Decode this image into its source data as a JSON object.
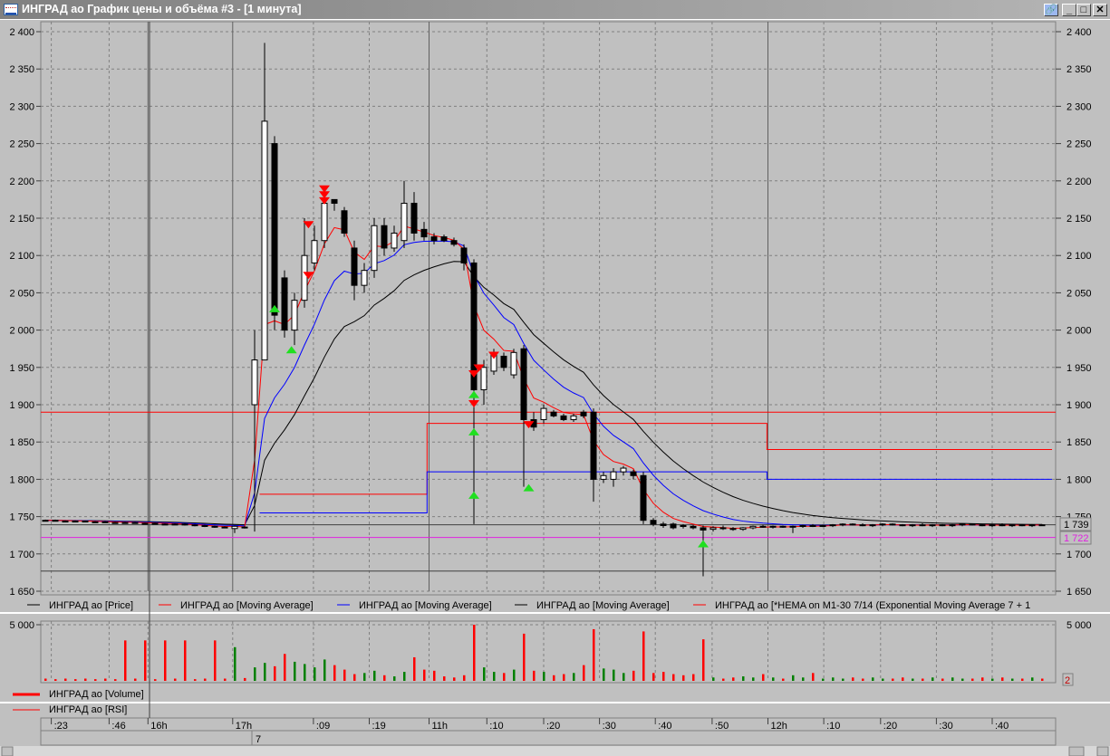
{
  "window": {
    "title": "ИНГРАД ао График цены и объёма #3 - [1 минута]",
    "min_glyph": "_",
    "max_glyph": "□",
    "close_glyph": "✕",
    "link_glyph": "🔗"
  },
  "colors": {
    "bg": "#c0c0c0",
    "grid": "#808080",
    "up": "#ffffff",
    "down": "#000000",
    "ma_red": "#ff0000",
    "ma_blue": "#0000ff",
    "ma_black": "#000000",
    "magenta": "#e020e0",
    "vol_up": "#008000",
    "vol_down": "#ff0000"
  },
  "legend": [
    {
      "label": "ИНГРАД ао [Price]",
      "color": "#000000"
    },
    {
      "label": "ИНГРАД ао [Moving Average]",
      "color": "#ff0000"
    },
    {
      "label": "ИНГРАД ао [Moving Average]",
      "color": "#0000ff"
    },
    {
      "label": "ИНГРАД ао [Moving Average]",
      "color": "#000000"
    },
    {
      "label": "ИНГРАД ао [*HEMA on M1-30 7/14 (Exponential Moving Average 7 + 1",
      "color": "#ff0000"
    }
  ],
  "volume_legend": "ИНГРАД ао [Volume]",
  "rsi_legend": "ИНГРАД ао [RSI]",
  "chart_data": {
    "type": "candlestick",
    "ylim": [
      1650,
      2400
    ],
    "yticks": [
      "2 400",
      "2 350",
      "2 300",
      "2 250",
      "2 200",
      "2 150",
      "2 100",
      "2 050",
      "2 000",
      "1 950",
      "1 900",
      "1 850",
      "1 800",
      "1 750",
      "1 700",
      "1 650"
    ],
    "ytick_values": [
      2400,
      2350,
      2300,
      2250,
      2200,
      2150,
      2100,
      2050,
      2000,
      1950,
      1900,
      1850,
      1800,
      1750,
      1700,
      1650
    ],
    "time_labels": [
      ":23",
      ":46",
      "16h",
      "17h",
      ":09",
      ":19",
      "11h",
      ":10",
      ":20",
      ":30",
      ":40",
      ":50",
      "12h",
      ":10",
      ":20",
      ":30",
      ":40"
    ],
    "time_label_bars": [
      0.6,
      6.4,
      10.3,
      18.8,
      26.9,
      32.5,
      38.5,
      44.3,
      50,
      55.6,
      61.2,
      66.9,
      72.5,
      78.1,
      83.8,
      89.4,
      95
    ],
    "date_label": "7",
    "ohlc": [
      [
        1745,
        1746,
        1744,
        1745
      ],
      [
        1745,
        1746,
        1744,
        1745
      ],
      [
        1744,
        1745,
        1743,
        1744
      ],
      [
        1744,
        1745,
        1743,
        1744
      ],
      [
        1744,
        1745,
        1743,
        1744
      ],
      [
        1743,
        1744,
        1742,
        1743
      ],
      [
        1743,
        1744,
        1742,
        1743
      ],
      [
        1742,
        1743,
        1741,
        1742
      ],
      [
        1742,
        1743,
        1741,
        1742
      ],
      [
        1742,
        1743,
        1741,
        1742
      ],
      [
        1741,
        1742,
        1740,
        1741
      ],
      [
        1741,
        1742,
        1740,
        1741
      ],
      [
        1740,
        1741,
        1739,
        1740
      ],
      [
        1740,
        1741,
        1739,
        1740
      ],
      [
        1740,
        1741,
        1738,
        1739
      ],
      [
        1739,
        1740,
        1737,
        1738
      ],
      [
        1738,
        1739,
        1736,
        1737
      ],
      [
        1737,
        1738,
        1735,
        1736
      ],
      [
        1736,
        1737,
        1735,
        1736
      ],
      [
        1734,
        1738,
        1728,
        1737
      ],
      [
        1736,
        1737,
        1734,
        1735
      ],
      [
        1900,
        2000,
        1730,
        1960
      ],
      [
        1960,
        2385,
        1960,
        2280
      ],
      [
        2250,
        2260,
        2000,
        2020
      ],
      [
        2070,
        2080,
        1990,
        2000
      ],
      [
        2000,
        2050,
        1980,
        2040
      ],
      [
        2040,
        2150,
        2030,
        2100
      ],
      [
        2090,
        2140,
        2080,
        2120
      ],
      [
        2120,
        2180,
        2110,
        2170
      ],
      [
        2175,
        2175,
        2160,
        2170
      ],
      [
        2160,
        2165,
        2125,
        2130
      ],
      [
        2110,
        2120,
        2040,
        2060
      ],
      [
        2060,
        2090,
        2050,
        2080
      ],
      [
        2080,
        2150,
        2070,
        2140
      ],
      [
        2140,
        2150,
        2100,
        2110
      ],
      [
        2110,
        2140,
        2105,
        2130
      ],
      [
        2120,
        2200,
        2110,
        2170
      ],
      [
        2170,
        2185,
        2120,
        2130
      ],
      [
        2135,
        2145,
        2120,
        2125
      ],
      [
        2125,
        2130,
        2115,
        2120
      ],
      [
        2125,
        2128,
        2118,
        2120
      ],
      [
        2120,
        2124,
        2112,
        2115
      ],
      [
        2110,
        2115,
        2080,
        2090
      ],
      [
        2090,
        2095,
        1740,
        1920
      ],
      [
        1920,
        1960,
        1900,
        1950
      ],
      [
        1945,
        1975,
        1940,
        1970
      ],
      [
        1965,
        1970,
        1945,
        1950
      ],
      [
        1940,
        1975,
        1935,
        1970
      ],
      [
        1975,
        1980,
        1790,
        1880
      ],
      [
        1880,
        1890,
        1865,
        1870
      ],
      [
        1880,
        1900,
        1875,
        1895
      ],
      [
        1890,
        1893,
        1883,
        1885
      ],
      [
        1885,
        1888,
        1878,
        1880
      ],
      [
        1880,
        1888,
        1877,
        1885
      ],
      [
        1890,
        1893,
        1882,
        1885
      ],
      [
        1890,
        1895,
        1770,
        1800
      ],
      [
        1800,
        1810,
        1795,
        1805
      ],
      [
        1800,
        1815,
        1790,
        1810
      ],
      [
        1810,
        1818,
        1805,
        1815
      ],
      [
        1810,
        1813,
        1800,
        1805
      ],
      [
        1805,
        1810,
        1740,
        1745
      ],
      [
        1745,
        1748,
        1737,
        1740
      ],
      [
        1740,
        1743,
        1735,
        1738
      ],
      [
        1740,
        1742,
        1733,
        1735
      ],
      [
        1738,
        1740,
        1734,
        1737
      ],
      [
        1737,
        1739,
        1733,
        1735
      ],
      [
        1735,
        1738,
        1670,
        1732
      ],
      [
        1733,
        1737,
        1730,
        1735
      ],
      [
        1735,
        1738,
        1732,
        1734
      ],
      [
        1734,
        1736,
        1731,
        1733
      ],
      [
        1733,
        1736,
        1731,
        1735
      ],
      [
        1735,
        1738,
        1733,
        1737
      ],
      [
        1737,
        1739,
        1735,
        1736
      ],
      [
        1736,
        1738,
        1734,
        1737
      ],
      [
        1737,
        1738,
        1735,
        1736
      ],
      [
        1736,
        1738,
        1728,
        1737
      ],
      [
        1737,
        1739,
        1735,
        1738
      ],
      [
        1738,
        1740,
        1736,
        1737
      ],
      [
        1737,
        1739,
        1736,
        1738
      ],
      [
        1738,
        1740,
        1736,
        1739
      ],
      [
        1739,
        1741,
        1737,
        1740
      ],
      [
        1740,
        1741,
        1738,
        1739
      ],
      [
        1739,
        1741,
        1737,
        1738
      ],
      [
        1738,
        1740,
        1736,
        1739
      ],
      [
        1739,
        1741,
        1737,
        1740
      ],
      [
        1740,
        1741,
        1738,
        1739
      ],
      [
        1739,
        1740,
        1737,
        1738
      ],
      [
        1738,
        1740,
        1736,
        1739
      ],
      [
        1739,
        1741,
        1737,
        1738
      ],
      [
        1738,
        1740,
        1736,
        1739
      ],
      [
        1739,
        1740,
        1737,
        1738
      ],
      [
        1738,
        1740,
        1736,
        1739
      ],
      [
        1739,
        1741,
        1737,
        1740
      ],
      [
        1740,
        1741,
        1738,
        1739
      ],
      [
        1739,
        1740,
        1737,
        1738
      ],
      [
        1738,
        1740,
        1736,
        1739
      ],
      [
        1739,
        1741,
        1737,
        1738
      ],
      [
        1738,
        1740,
        1736,
        1739
      ],
      [
        1739,
        1740,
        1737,
        1738
      ],
      [
        1738,
        1740,
        1736,
        1739
      ],
      [
        1739,
        1740,
        1738,
        1739
      ]
    ],
    "ma_periods": {
      "red": 4,
      "blue": 9,
      "black": 16
    },
    "volume": [
      200,
      150,
      200,
      150,
      200,
      150,
      200,
      150,
      3600,
      200,
      3600,
      150,
      3600,
      200,
      3600,
      150,
      200,
      3600,
      200,
      3000,
      250,
      1200,
      1600,
      1300,
      2400,
      1700,
      1500,
      1200,
      1900,
      1400,
      1000,
      600,
      700,
      900,
      500,
      400,
      800,
      2100,
      1000,
      900,
      400,
      300,
      500,
      5000,
      1200,
      800,
      700,
      1000,
      4200,
      900,
      800,
      500,
      600,
      700,
      1400,
      4600,
      1100,
      1000,
      700,
      900,
      4400,
      700,
      800,
      600,
      500,
      600,
      3700,
      300,
      200,
      300,
      400,
      300,
      600,
      300,
      200,
      500,
      300,
      700,
      200,
      300,
      200,
      300,
      200,
      300,
      200,
      200,
      300,
      200,
      200,
      300,
      200,
      300,
      200,
      200,
      300,
      200,
      300,
      200,
      200,
      300,
      200
    ],
    "volume_ylim": [
      0,
      5000
    ],
    "volume_ticks": [
      "5 000"
    ],
    "volume_last": "2",
    "last_price": "1 739",
    "level_price": "1 722",
    "hlines": [
      {
        "price": 1890,
        "color": "#ff0000"
      },
      {
        "price": 1722,
        "color": "#e020e0"
      },
      {
        "price": 1739,
        "color": "#404040"
      },
      {
        "price": 1677,
        "color": "#404040"
      }
    ],
    "step_lines": [
      {
        "color": "#ff0000",
        "segments": [
          [
            21.5,
            38.3,
            1780
          ],
          [
            38.3,
            72.4,
            1875
          ],
          [
            72.4,
            101,
            1840
          ]
        ]
      },
      {
        "color": "#0000ff",
        "segments": [
          [
            21.5,
            38.3,
            1755
          ],
          [
            38.3,
            72.4,
            1810
          ],
          [
            72.4,
            101,
            1800
          ]
        ]
      }
    ],
    "buy_signals": [
      [
        23,
        2030
      ],
      [
        24.7,
        1975
      ],
      [
        43,
        1915
      ],
      [
        43,
        1865
      ],
      [
        43,
        1780
      ],
      [
        48.5,
        1790
      ],
      [
        66,
        1715
      ]
    ],
    "sell_signals": [
      [
        26.4,
        2140
      ],
      [
        26.4,
        2072
      ],
      [
        28,
        2188
      ],
      [
        28,
        2180
      ],
      [
        28,
        2172
      ],
      [
        43,
        1940
      ],
      [
        43.5,
        1948
      ],
      [
        43,
        1900
      ],
      [
        45,
        1965
      ],
      [
        48.5,
        1872
      ]
    ]
  }
}
